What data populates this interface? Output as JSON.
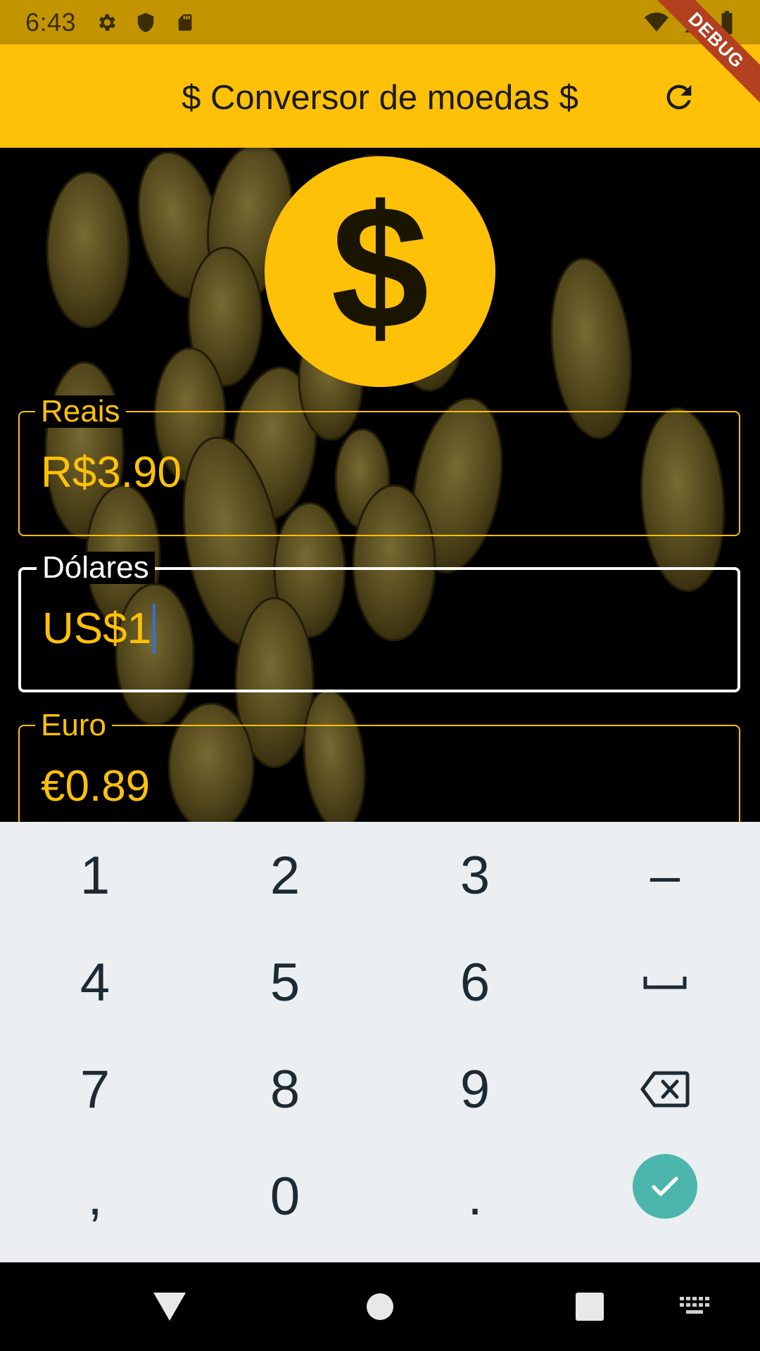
{
  "status_bar": {
    "time": "6:43",
    "left_icons": [
      "settings-icon",
      "shield-icon",
      "sd-card-icon"
    ],
    "right_icons": [
      "wifi-icon",
      "cell-signal-icon",
      "battery-icon"
    ]
  },
  "debug_banner": "DEBUG",
  "app_bar": {
    "title": "$ Conversor de moedas $",
    "action_icon": "refresh-icon"
  },
  "logo_icon": "dollar-circle-icon",
  "fields": [
    {
      "label": "Reais",
      "value": "R$3.90",
      "focused": false
    },
    {
      "label": "Dólares",
      "value": "US$1",
      "focused": true
    },
    {
      "label": "Euro",
      "value": "€0.89",
      "focused": false
    }
  ],
  "keyboard": {
    "rows": [
      [
        "1",
        "2",
        "3",
        "–"
      ],
      [
        "4",
        "5",
        "6",
        "space"
      ],
      [
        "7",
        "8",
        "9",
        "backspace"
      ],
      [
        ",",
        "0",
        ".",
        "done"
      ]
    ]
  },
  "nav_bar": [
    "back-icon",
    "home-icon",
    "recents-icon",
    "keyboard-switch-icon"
  ],
  "colors": {
    "accent": "#FFC107",
    "status_bar": "#C29400",
    "keyboard_bg": "#EBEFF2",
    "done_key": "#4DB6AC",
    "debug_ribbon": "#B3401F"
  }
}
